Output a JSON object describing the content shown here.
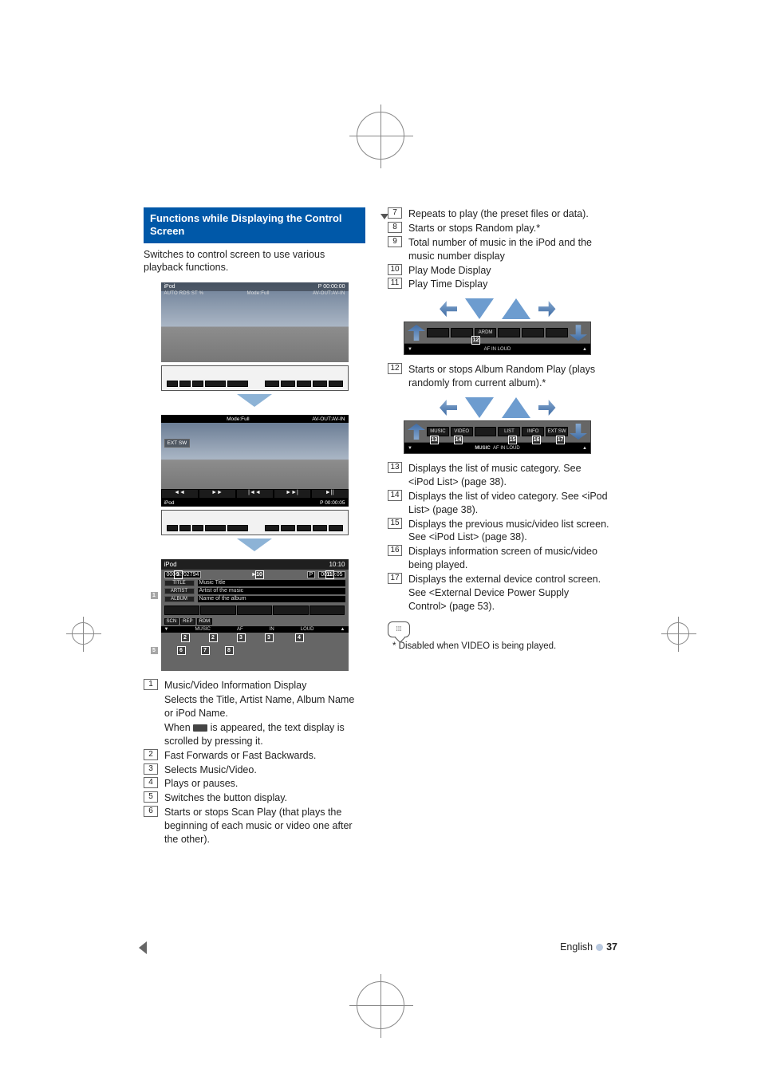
{
  "section": {
    "title": "Functions while Displaying the Control Screen",
    "subtitle": "Switches to control screen to use various playback functions."
  },
  "shot1": {
    "title_left": "iPod",
    "title_right": "P 00:00:00",
    "row2_left": "AUTO   RDS    ST    %",
    "row2_center": "Mode:Full",
    "row2_right": "AV-OUT:AV-IN"
  },
  "shot2": {
    "hdr_center": "Mode:Full",
    "hdr_right": "AV-OUT:AV-IN",
    "extsw": "EXT SW",
    "ft_left": "iPod",
    "ft_right": "P  00:00:05"
  },
  "shot3": {
    "title": "iPod",
    "clock": "10:10",
    "count": "00002/02794",
    "play_p": "P",
    "play_time": "00:00:05",
    "rows": {
      "title_lbl": "TITLE",
      "title_val": "Music Title",
      "artist_lbl": "ARTIST",
      "artist_val": "Artist of the music",
      "album_lbl": "ALBUM",
      "album_val": "Name of the album"
    },
    "bottom": {
      "scn": "SCN",
      "rep": "REP",
      "rdm": "RDM"
    },
    "foot": {
      "music": "MUSIC",
      "af": "AF",
      "in": "IN",
      "loud": "LOUD"
    }
  },
  "left_list": {
    "i1": "Music/Video Information Display",
    "i1b": "Selects the Title, Artist Name, Album Name or iPod Name.",
    "i1c_a": "When ",
    "i1c_b": " is appeared, the text display is scrolled by pressing it.",
    "i2": "Fast Forwards or Fast Backwards.",
    "i3": "Selects Music/Video.",
    "i4": "Plays or pauses.",
    "i5": "Switches the button display.",
    "i6": "Starts or stops Scan Play (that plays the beginning of each music or video one after the other)."
  },
  "right_list_a": {
    "i7": "Repeats to play (the preset files or data).",
    "i8": "Starts or stops Random play.*",
    "i9": "Total number of music in the iPod and the music number display",
    "i10": "Play Mode Display",
    "i11": "Play Time Display"
  },
  "strip1": {
    "ardm": "ARDM",
    "foot_center": "AF            IN                        LOUD"
  },
  "right_list_b": {
    "i12": "Starts or stops Album Random Play (plays randomly from current album).*"
  },
  "strip2": {
    "music": "MUSIC",
    "video": "VIDEO",
    "list": "LIST",
    "info": "INFO",
    "extsw": "EXT SW",
    "foot_left": "MUSIC",
    "foot_center": "AF                    IN                               LOUD"
  },
  "right_list_c": {
    "i13": "Displays the list of music category. See <iPod List> (page 38).",
    "i14": "Displays the list of video category. See <iPod List> (page 38).",
    "i15": "Displays the previous music/video list screen. See <iPod List> (page 38).",
    "i16": "Displays information screen of music/video being played.",
    "i17": "Displays the external device control screen. See <External Device Power Supply Control> (page 53)."
  },
  "note": "* Disabled when VIDEO is being played.",
  "pagenum": {
    "lang": "English",
    "num": "37"
  }
}
